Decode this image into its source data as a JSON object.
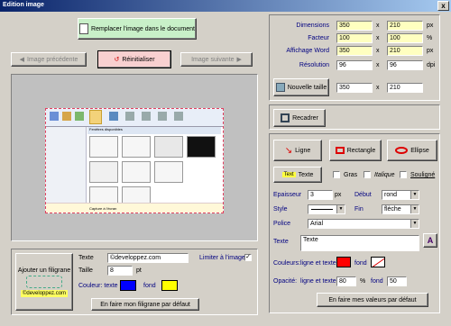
{
  "window": {
    "title": "Edition image",
    "close_glyph": "x"
  },
  "toolbar": {
    "replace_label": "Remplacer l'image dans le document",
    "prev_label": "Image précédente",
    "reset_label": "Réinitialiser",
    "next_label": "Image suivante"
  },
  "preview": {
    "caption": "Capture à l'écran",
    "panel_title": "Fenêtres disponibles"
  },
  "watermark": {
    "add_label": "Ajouter un filigrane",
    "logo_text": "developpez.com",
    "texte_label": "Texte",
    "texte_value": "©developpez.com",
    "taille_label": "Taille",
    "taille_value": "8",
    "taille_unit": "pt",
    "couleur_label": "Couleur: texte",
    "fond_label": "fond",
    "text_color": "#0000ff",
    "bg_color": "#ffff00",
    "default_button": "En faire mon filigrane par défaut"
  },
  "limit": {
    "label": "Limiter à l'image",
    "checked_glyph": "✓"
  },
  "dimensions": {
    "rows": [
      {
        "label": "Dimensions",
        "v1": "350",
        "v2": "210",
        "unit": "px"
      },
      {
        "label": "Facteur",
        "v1": "100",
        "v2": "100",
        "unit": "%"
      },
      {
        "label": "Affichage Word",
        "v1": "350",
        "v2": "210",
        "unit": "px"
      },
      {
        "label": "Résolution",
        "v1": "96",
        "v2": "96",
        "unit": "dpi"
      }
    ],
    "sep": "x",
    "new_size_label": "Nouvelle taille",
    "new_w": "350",
    "new_h": "210"
  },
  "crop": {
    "label": "Recadrer"
  },
  "drawing": {
    "ligne": "Ligne",
    "rectangle": "Rectangle",
    "ellipse": "Ellipse",
    "texte_icon": "Text",
    "texte": "Texte",
    "gras": "Gras",
    "italique": "Italique",
    "souligne": "Souligné",
    "epaisseur_label": "Epaisseur",
    "epaisseur_value": "3",
    "epaisseur_unit": "px",
    "debut_label": "Début",
    "debut_value": "rond",
    "style_label": "Style",
    "fin_label": "Fin",
    "fin_value": "flèche",
    "police_label": "Police",
    "police_value": "Arial",
    "texte_label": "Texte",
    "texte_value": "Texte",
    "couleurs_label": "Couleurs:",
    "ligne_texte_label": "ligne et texte",
    "fond_label": "fond",
    "line_color": "#ff0000",
    "opacite_label": "Opacité:",
    "opacite_ligne_label": "ligne et texte",
    "opacite_ligne_value": "80",
    "opacite_pct": "%",
    "opacite_fond_label": "fond",
    "opacite_fond_value": "50",
    "default_button": "En faire mes valeurs par défaut"
  }
}
